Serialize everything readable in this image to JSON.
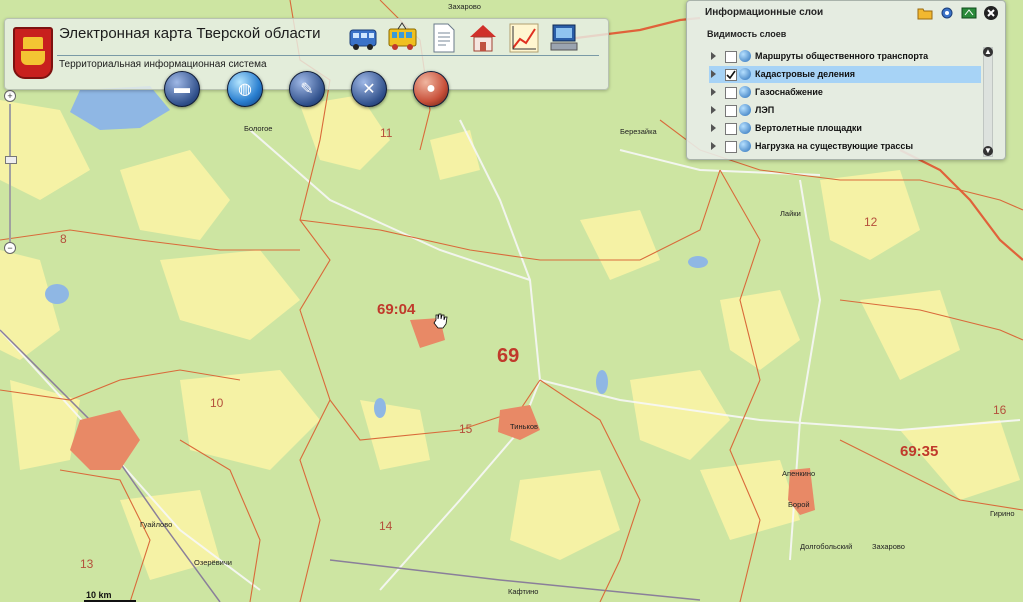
{
  "header": {
    "title": "Электронная карта Тверской области",
    "subtitle": "Территориальная информационная система",
    "tool_icons": [
      "bus-icon",
      "tram-icon",
      "document-icon",
      "house-icon",
      "chart-icon",
      "computer-icon"
    ],
    "round_icons": [
      "truck-icon",
      "globe-icon",
      "pen-icon",
      "wrench-icon",
      "meat-icon"
    ]
  },
  "layers_panel": {
    "title": "Информационные слои",
    "visibility_title": "Видимость слоев",
    "items": [
      {
        "label": "Маршруты общественного транспорта",
        "checked": false,
        "selected": false
      },
      {
        "label": "Кадастровые деления",
        "checked": true,
        "selected": true
      },
      {
        "label": "Газоснабжение",
        "checked": false,
        "selected": false
      },
      {
        "label": "ЛЭП",
        "checked": false,
        "selected": false
      },
      {
        "label": "Вертолетные площадки",
        "checked": false,
        "selected": false
      },
      {
        "label": "Нагрузка на существующие трассы",
        "checked": false,
        "selected": false
      }
    ]
  },
  "map": {
    "region_code_main": "69",
    "district_codes": [
      "69:04",
      "69:35"
    ],
    "quarter_numbers": [
      "11",
      "8",
      "12",
      "16",
      "15",
      "14",
      "13",
      "10"
    ],
    "place_names": [
      "Захарово",
      "Бологое",
      "Березайка",
      "Лайки",
      "Тиньков",
      "Гуайлово",
      "Озерёвичи",
      "Апенкино",
      "Борой",
      "Долгобольский",
      "Захарово",
      "Гирино",
      "Кафтино"
    ],
    "scale_label": "10 km"
  },
  "zoom": {
    "plus": "+",
    "minus": "−"
  }
}
